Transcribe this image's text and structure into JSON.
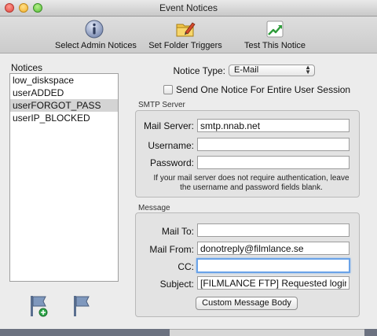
{
  "window": {
    "title": "Event Notices"
  },
  "toolbar": {
    "items": [
      {
        "label": "Select Admin Notices",
        "icon": "info-icon"
      },
      {
        "label": "Set Folder Triggers",
        "icon": "folder-pencil-icon"
      },
      {
        "label": "Test This Notice",
        "icon": "test-arrow-icon"
      }
    ]
  },
  "notices": {
    "heading": "Notices",
    "items": [
      "low_diskspace",
      "userADDED",
      "userFORGOT_PASS",
      "userIP_BLOCKED"
    ],
    "selected": "userFORGOT_PASS"
  },
  "notice_type": {
    "label": "Notice Type:",
    "value": "E-Mail"
  },
  "single_notice": {
    "label": "Send One Notice For Entire User Session",
    "checked": false
  },
  "smtp": {
    "title": "SMTP Server",
    "mail_server_label": "Mail Server:",
    "mail_server_value": "smtp.nnab.net",
    "username_label": "Username:",
    "username_value": "",
    "password_label": "Password:",
    "password_value": "",
    "note": "If your mail server does not require authentication, leave the username and password fields blank."
  },
  "message": {
    "title": "Message",
    "mail_to_label": "Mail To:",
    "mail_to_value": "",
    "mail_from_label": "Mail From:",
    "mail_from_value": "donotreply@filmlance.se",
    "cc_label": "CC:",
    "cc_value": "",
    "subject_label": "Subject:",
    "subject_value": "[FILMLANCE FTP] Requested login infor",
    "custom_body_button": "Custom Message Body"
  },
  "colors": {
    "focus_ring": "#6aa3e8",
    "selection": "#d4d4d4"
  }
}
